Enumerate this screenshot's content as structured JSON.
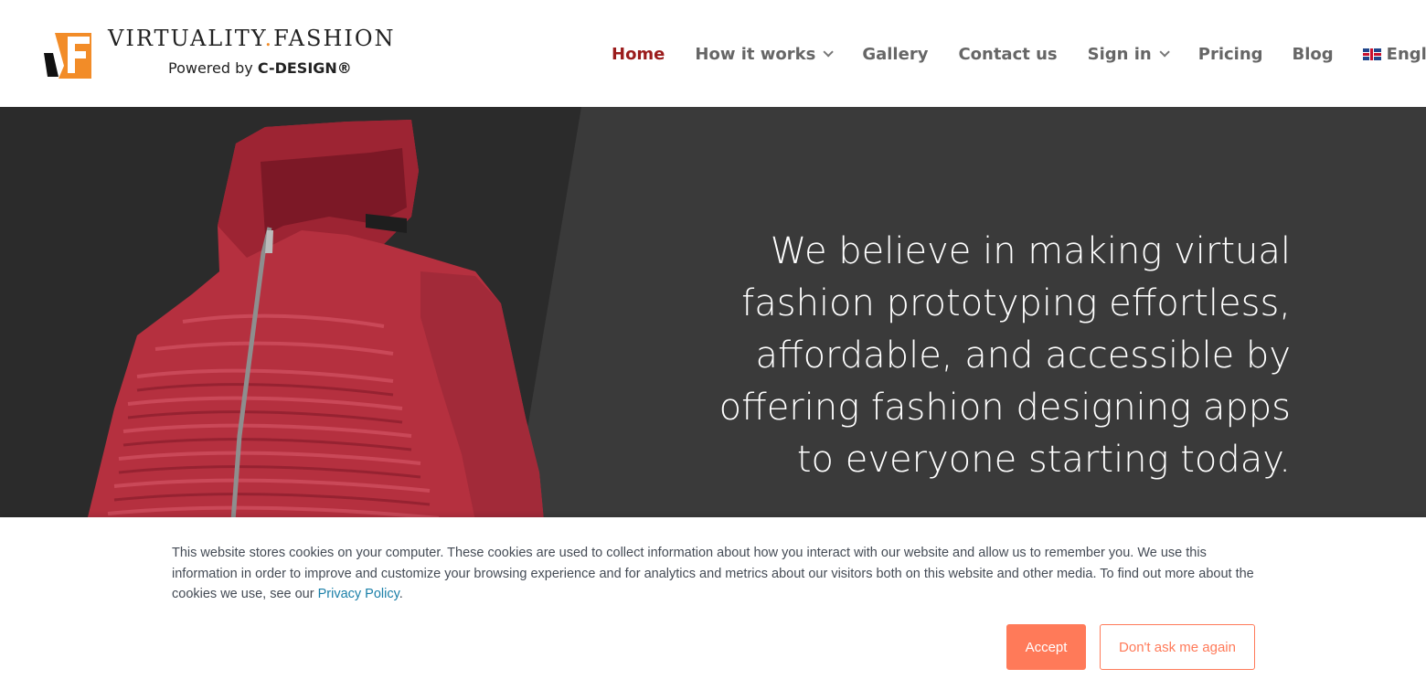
{
  "logo": {
    "brand_prefix": "VIRTUALITY",
    "brand_dot": ".",
    "brand_suffix": "FASHION",
    "powered_prefix": "Powered by ",
    "powered_brand": "C-DESIGN®"
  },
  "nav": {
    "items": [
      {
        "label": "Home",
        "active": true,
        "dropdown": false
      },
      {
        "label": "How it works",
        "active": false,
        "dropdown": true
      },
      {
        "label": "Gallery",
        "active": false,
        "dropdown": false
      },
      {
        "label": "Contact us",
        "active": false,
        "dropdown": false
      },
      {
        "label": "Sign in",
        "active": false,
        "dropdown": true
      },
      {
        "label": "Pricing",
        "active": false,
        "dropdown": false
      },
      {
        "label": "Blog",
        "active": false,
        "dropdown": false
      },
      {
        "label": "English",
        "active": false,
        "dropdown": true,
        "icon": "uk-flag-icon"
      }
    ]
  },
  "hero": {
    "headline": "We believe in making virtual\nfashion prototyping effortless,\naffordable, and accessible by\noffering fashion designing apps\nto everyone starting today."
  },
  "cookie_banner": {
    "text": "This website stores cookies on your computer. These cookies are used to collect information about how you interact with our website and allow us to remember you. We use this information in order to improve and customize your browsing experience and for analytics and metrics about our visitors both on this website and other media. To find out more about the cookies we use, see our ",
    "link_label": "Privacy Policy",
    "text_end": ".",
    "accept_label": "Accept",
    "decline_label": "Don't ask me again"
  },
  "colors": {
    "nav_active": "#9b1c1c",
    "nav_text": "#666666",
    "hero_bg": "#3a3a3a",
    "jacket": "#c0394b",
    "logo_orange": "#f28c28",
    "button_accent": "#ff7a59",
    "link": "#1a7fa8"
  }
}
